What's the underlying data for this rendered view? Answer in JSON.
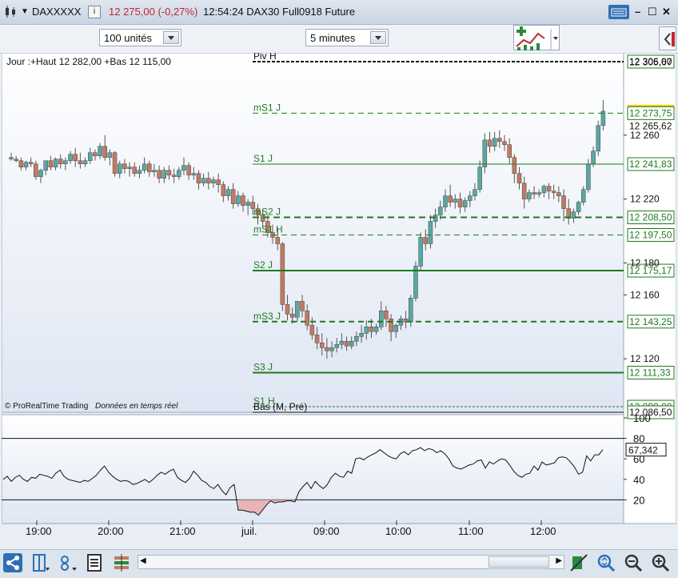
{
  "window": {
    "symbol": "DAXXXXX",
    "price_change": "12 275,00 (-0,27%)",
    "time_instrument": "12:54:24 DAX30 Full0918 Future"
  },
  "toolbar": {
    "units_selector": "100 unités",
    "interval_selector": "5 minutes"
  },
  "chart_header": {
    "day_range": "Jour :+Haut 12 282,00 +Bas 12 115,00",
    "credit": "© ProRealTime Trading",
    "realtime": "Données en temps réel"
  },
  "price_axis": {
    "levels": [
      {
        "value": "12 306,00",
        "label_text": "Piv H"
      },
      {
        "value": "12 305,67",
        "label_text": ""
      },
      {
        "value": "12 275,00",
        "label_text": "",
        "highlight": true
      },
      {
        "value": "12 273,75",
        "label_text": "mS1 J"
      },
      {
        "value": "12 265,62",
        "label_text": ""
      },
      {
        "value": "12 241,83",
        "label_text": "S1 J"
      },
      {
        "value": "12 208,50",
        "label_text": "mS2 J"
      },
      {
        "value": "12 197,50",
        "label_text": "mS1 H"
      },
      {
        "value": "12 175,17",
        "label_text": "S2 J"
      },
      {
        "value": "12 143,25",
        "label_text": "mS3 J"
      },
      {
        "value": "12 111,33",
        "label_text": "S3 J"
      },
      {
        "value": "12 090,00",
        "label_text": "S1 H"
      },
      {
        "value": "12 086,50",
        "label_text": "Bas (M, Pré)"
      }
    ],
    "ticks": [
      "12 260",
      "12 220",
      "12 180",
      "12 160",
      "12 120"
    ]
  },
  "indicator": {
    "current_value": "67,342",
    "ticks": [
      "100",
      "80",
      "60",
      "40",
      "20"
    ],
    "values": [
      40,
      43,
      38,
      42,
      44,
      40,
      38,
      42,
      41,
      45,
      44,
      43,
      41,
      46,
      49,
      43,
      40,
      39,
      38,
      37,
      39,
      38,
      41,
      44,
      49,
      53,
      47,
      43,
      40,
      38,
      39,
      38,
      35,
      36,
      38,
      40,
      37,
      40,
      44,
      47,
      45,
      48,
      50,
      42,
      39,
      37,
      41,
      48,
      44,
      39,
      37,
      33,
      31,
      35,
      29,
      25,
      32,
      35,
      10,
      10,
      9,
      8,
      8,
      5,
      10,
      15,
      19,
      17,
      18,
      18,
      19,
      19,
      18,
      28,
      33,
      37,
      31,
      38,
      34,
      31,
      35,
      42,
      46,
      43,
      42,
      48,
      46,
      60,
      61,
      59,
      62,
      64,
      66,
      69,
      66,
      63,
      61,
      60,
      65,
      67,
      64,
      68,
      69,
      71,
      68,
      70,
      69,
      66,
      68,
      65,
      60,
      53,
      51,
      50,
      52,
      54,
      55,
      58,
      59,
      51,
      57,
      55,
      58,
      60,
      59,
      54,
      48,
      44,
      42,
      45,
      46,
      53,
      49,
      57,
      54,
      55,
      56,
      61,
      62,
      61,
      57,
      52,
      45,
      47,
      63,
      58,
      64,
      64,
      69
    ]
  },
  "time_axis": [
    "19:00",
    "20:00",
    "21:00",
    "juil.",
    "09:00",
    "10:00",
    "11:00",
    "12:00"
  ],
  "chart_data": {
    "type": "candlestick",
    "title": "DAX30 Full0918 Future",
    "interval": "5 minutes",
    "y_range": [
      12085,
      12310
    ],
    "candles": [
      [
        12245,
        12249,
        12246,
        12244
      ],
      [
        12245,
        12247,
        12244,
        12243
      ],
      [
        12244,
        12246,
        12240,
        12238
      ],
      [
        12240,
        12244,
        12243,
        12238
      ],
      [
        12243,
        12246,
        12242,
        12240
      ],
      [
        12242,
        12244,
        12234,
        12232
      ],
      [
        12234,
        12239,
        12238,
        12230
      ],
      [
        12238,
        12240,
        12244,
        12235
      ],
      [
        12244,
        12247,
        12240,
        12238
      ],
      [
        12240,
        12246,
        12245,
        12238
      ],
      [
        12245,
        12248,
        12242,
        12239
      ],
      [
        12242,
        12246,
        12244,
        12238
      ],
      [
        12244,
        12250,
        12248,
        12242
      ],
      [
        12248,
        12252,
        12244,
        12240
      ],
      [
        12244,
        12249,
        12242,
        12239
      ],
      [
        12242,
        12246,
        12244,
        12240
      ],
      [
        12244,
        12252,
        12249,
        12242
      ],
      [
        12249,
        12251,
        12247,
        12244
      ],
      [
        12247,
        12255,
        12253,
        12245
      ],
      [
        12253,
        12260,
        12246,
        12244
      ],
      [
        12246,
        12251,
        12249,
        12241
      ],
      [
        12249,
        12250,
        12236,
        12234
      ],
      [
        12236,
        12244,
        12242,
        12233
      ],
      [
        12242,
        12245,
        12239,
        12236
      ],
      [
        12239,
        12243,
        12240,
        12234
      ],
      [
        12240,
        12243,
        12236,
        12234
      ],
      [
        12236,
        12241,
        12238,
        12233
      ],
      [
        12238,
        12246,
        12242,
        12236
      ],
      [
        12242,
        12244,
        12237,
        12234
      ],
      [
        12237,
        12242,
        12238,
        12234
      ],
      [
        12238,
        12241,
        12233,
        12230
      ],
      [
        12233,
        12240,
        12238,
        12230
      ],
      [
        12238,
        12241,
        12235,
        12232
      ],
      [
        12235,
        12239,
        12234,
        12230
      ],
      [
        12234,
        12240,
        12238,
        12232
      ],
      [
        12238,
        12246,
        12241,
        12235
      ],
      [
        12241,
        12243,
        12235,
        12232
      ],
      [
        12235,
        12240,
        12236,
        12232
      ],
      [
        12236,
        12238,
        12230,
        12226
      ],
      [
        12230,
        12236,
        12233,
        12228
      ],
      [
        12233,
        12237,
        12230,
        12226
      ],
      [
        12230,
        12234,
        12232,
        12227
      ],
      [
        12232,
        12236,
        12229,
        12224
      ],
      [
        12229,
        12231,
        12222,
        12218
      ],
      [
        12222,
        12228,
        12226,
        12219
      ],
      [
        12226,
        12230,
        12217,
        12214
      ],
      [
        12217,
        12225,
        12222,
        12215
      ],
      [
        12222,
        12224,
        12216,
        12212
      ],
      [
        12216,
        12220,
        12218,
        12210
      ],
      [
        12218,
        12222,
        12214,
        12210
      ],
      [
        12214,
        12217,
        12210,
        12204
      ],
      [
        12210,
        12214,
        12206,
        12202
      ],
      [
        12206,
        12210,
        12199,
        12196
      ],
      [
        12199,
        12204,
        12196,
        12192
      ],
      [
        12196,
        12202,
        12192,
        12188
      ],
      [
        12192,
        12193,
        12154,
        12150
      ],
      [
        12154,
        12160,
        12148,
        12144
      ],
      [
        12148,
        12152,
        12146,
        12142
      ],
      [
        12146,
        12149,
        12156,
        12143
      ],
      [
        12156,
        12160,
        12150,
        12146
      ],
      [
        12150,
        12154,
        12141,
        12138
      ],
      [
        12141,
        12146,
        12135,
        12132
      ],
      [
        12135,
        12140,
        12130,
        12126
      ],
      [
        12130,
        12136,
        12127,
        12122
      ],
      [
        12127,
        12133,
        12125,
        12120
      ],
      [
        12125,
        12131,
        12127,
        12121
      ],
      [
        12127,
        12133,
        12129,
        12124
      ],
      [
        12129,
        12136,
        12131,
        12126
      ],
      [
        12131,
        12134,
        12128,
        12125
      ],
      [
        12128,
        12134,
        12131,
        12126
      ],
      [
        12131,
        12137,
        12134,
        12128
      ],
      [
        12134,
        12141,
        12136,
        12130
      ],
      [
        12136,
        12144,
        12140,
        12132
      ],
      [
        12140,
        12145,
        12137,
        12133
      ],
      [
        12137,
        12142,
        12140,
        12135
      ],
      [
        12140,
        12156,
        12150,
        12138
      ],
      [
        12150,
        12153,
        12145,
        12140
      ],
      [
        12145,
        12148,
        12137,
        12131
      ],
      [
        12137,
        12142,
        12141,
        12133
      ],
      [
        12141,
        12147,
        12145,
        12138
      ],
      [
        12145,
        12150,
        12143,
        12139
      ],
      [
        12143,
        12160,
        12158,
        12140
      ],
      [
        12158,
        12181,
        12178,
        12156
      ],
      [
        12178,
        12199,
        12196,
        12175
      ],
      [
        12196,
        12201,
        12192,
        12188
      ],
      [
        12192,
        12210,
        12206,
        12189
      ],
      [
        12206,
        12214,
        12210,
        12202
      ],
      [
        12210,
        12219,
        12215,
        12207
      ],
      [
        12215,
        12226,
        12222,
        12212
      ],
      [
        12222,
        12229,
        12218,
        12215
      ],
      [
        12218,
        12223,
        12220,
        12214
      ],
      [
        12220,
        12224,
        12215,
        12211
      ],
      [
        12215,
        12221,
        12219,
        12212
      ],
      [
        12219,
        12225,
        12222,
        12215
      ],
      [
        12222,
        12230,
        12226,
        12219
      ],
      [
        12226,
        12244,
        12240,
        12224
      ],
      [
        12240,
        12261,
        12257,
        12236
      ],
      [
        12257,
        12262,
        12253,
        12249
      ],
      [
        12253,
        12262,
        12258,
        12250
      ],
      [
        12258,
        12263,
        12256,
        12252
      ],
      [
        12256,
        12260,
        12254,
        12250
      ],
      [
        12254,
        12258,
        12246,
        12242
      ],
      [
        12246,
        12248,
        12236,
        12230
      ],
      [
        12236,
        12240,
        12230,
        12226
      ],
      [
        12230,
        12234,
        12220,
        12214
      ],
      [
        12220,
        12226,
        12224,
        12218
      ],
      [
        12224,
        12228,
        12223,
        12220
      ],
      [
        12223,
        12226,
        12224,
        12221
      ],
      [
        12224,
        12229,
        12228,
        12221
      ],
      [
        12228,
        12230,
        12225,
        12220
      ],
      [
        12225,
        12229,
        12224,
        12220
      ],
      [
        12224,
        12228,
        12222,
        12218
      ],
      [
        12222,
        12226,
        12214,
        12206
      ],
      [
        12214,
        12220,
        12208,
        12204
      ],
      [
        12208,
        12214,
        12212,
        12205
      ],
      [
        12212,
        12219,
        12218,
        12210
      ],
      [
        12218,
        12228,
        12226,
        12216
      ],
      [
        12226,
        12245,
        12242,
        12224
      ],
      [
        12242,
        12253,
        12250,
        12240
      ],
      [
        12250,
        12269,
        12266,
        12247
      ],
      [
        12266,
        12282,
        12275,
        12263
      ]
    ]
  },
  "colors": {
    "up": "#5aa8a3",
    "down": "#c27a62",
    "level_line": "#1e7a1e",
    "highlight_bg": "#ffcc00",
    "oversold_fill": "#e8b4b8"
  }
}
